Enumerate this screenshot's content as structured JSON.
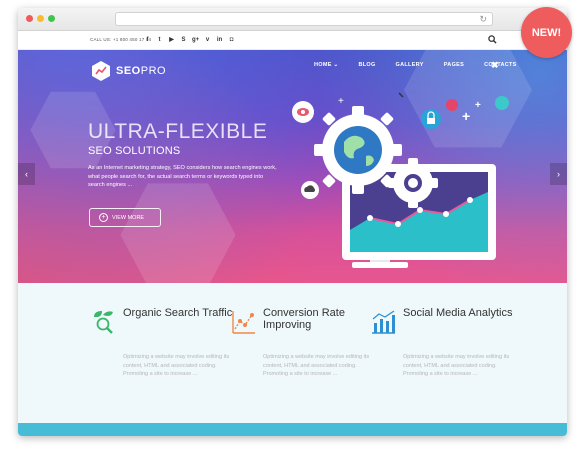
{
  "topbar": {
    "callus": "CALL US: +1 800 450 17 04",
    "social_icons": [
      {
        "name": "facebook-icon",
        "glyph": "f"
      },
      {
        "name": "twitter-icon",
        "glyph": "t"
      },
      {
        "name": "youtube-icon",
        "glyph": "▶"
      },
      {
        "name": "skype-icon",
        "glyph": "S"
      },
      {
        "name": "google-plus-icon",
        "glyph": "g+"
      },
      {
        "name": "vimeo-icon",
        "glyph": "v"
      },
      {
        "name": "linkedin-icon",
        "glyph": "in"
      },
      {
        "name": "instagram-icon",
        "glyph": "◘"
      }
    ]
  },
  "brand": {
    "name_bold": "SEO",
    "name_light": "PRO"
  },
  "nav": {
    "items": [
      "HOME",
      "BLOG",
      "GALLERY",
      "PAGES",
      "CONTACTS"
    ],
    "home_arrow": "⌄",
    "close": "✖"
  },
  "hero": {
    "title": "ULTRA-FLEXIBLE",
    "subtitle": "SEO SOLUTIONS",
    "description": "As an Internet marketing strategy, SEO considers how search engines work, what people search for, the actual search terms or keywords typed into search engines ...",
    "button_label": "VIEW MORE",
    "button_icon": "+",
    "prev": "‹",
    "next": "›"
  },
  "features": [
    {
      "title": "Organic Search Traffic",
      "text": "Optimizing a website may involve editing its content, HTML and associated coding. Promoting a site to increase ...",
      "icon": "leaf-magnifier-icon"
    },
    {
      "title": "Conversion Rate Improving",
      "text": "Optimizing a website may involve editing its content, HTML and associated coding. Promoting a site to increase ...",
      "icon": "line-chart-icon"
    },
    {
      "title": "Social Media Analytics",
      "text": "Optimizing a website may involve editing its content, HTML and associated coding. Promoting a site to increase ...",
      "icon": "bar-chart-icon"
    }
  ],
  "badge": "NEW!",
  "colors": {
    "accent_green": "#3db56a",
    "accent_orange": "#f0884b",
    "accent_blue": "#2e8fd1",
    "strip": "#46bcd7",
    "badge": "#ef5c5e"
  }
}
